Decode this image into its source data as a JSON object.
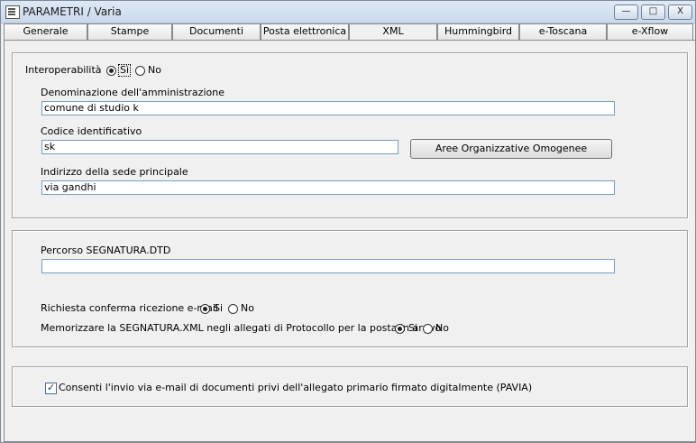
{
  "window": {
    "title": "PARAMETRI / Varia",
    "controls": {
      "minimize": "—",
      "maximize": "□",
      "close": "X"
    }
  },
  "tabs": [
    {
      "label": "Generale"
    },
    {
      "label": "Stampe"
    },
    {
      "label": "Documenti"
    },
    {
      "label": "Posta elettronica"
    },
    {
      "label": "XML"
    },
    {
      "label": "Hummingbird"
    },
    {
      "label": "e-Toscana"
    },
    {
      "label": "e-Xflow"
    }
  ],
  "active_tab": "XML",
  "interop": {
    "label": "Interoperabilità",
    "yes": "Sì",
    "no": "No",
    "selected": "Sì",
    "denominazione_label": "Denominazione dell'amministrazione",
    "denominazione_value": "comune di studio k",
    "codice_label": "Codice identificativo",
    "codice_value": "sk",
    "aree_button": "Aree Organizzative Omogenee",
    "indirizzo_label": "Indirizzo della sede principale",
    "indirizzo_value": "via gandhi"
  },
  "segnatura": {
    "percorso_label": "Percorso SEGNATURA.DTD",
    "percorso_value": "",
    "conferma_label": "Richiesta conferma ricezione e-mail",
    "conferma_yes": "Si",
    "conferma_no": "No",
    "conferma_selected": "Si",
    "memorizza_label": "Memorizzare la SEGNATURA.XML negli allegati di Protocollo per la posta in arrivo",
    "memorizza_yes": "Si",
    "memorizza_no": "No",
    "memorizza_selected": "Si"
  },
  "pavia": {
    "label": "Consenti l'invio via e-mail di documenti privi dell'allegato primario firmato digitalmente (PAVIA)",
    "checked": true
  }
}
